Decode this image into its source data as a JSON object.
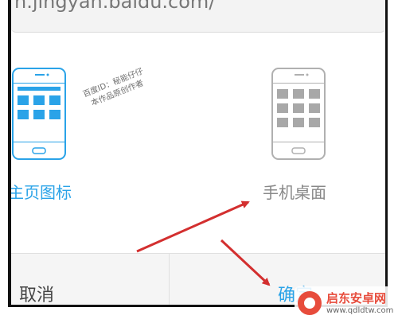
{
  "url_bar": {
    "text": "n.jingyan.baidu.com/"
  },
  "options": [
    {
      "label": "主页图标",
      "icon": "phone-grid-icon",
      "selected": true,
      "color": "#2aa3e8"
    },
    {
      "label": "手机桌面",
      "icon": "phone-grid-icon",
      "selected": false,
      "color": "#888888"
    }
  ],
  "watermark": {
    "line1": "百度ID：秘能仔仔",
    "line2": "本作品原创作者"
  },
  "actions": {
    "cancel_label": "取消",
    "confirm_label": "确定"
  },
  "site_badge": {
    "name": "启东安卓网",
    "url": "www.qdldtw.com"
  },
  "colors": {
    "accent": "#2aa3e8",
    "inactive": "#888888",
    "arrow": "#d32f2f"
  }
}
